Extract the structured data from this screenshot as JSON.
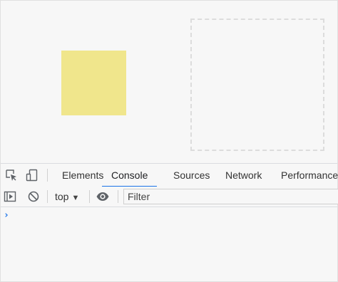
{
  "page": {
    "square_color": "#f0e68c",
    "dropzone_border_color": "#dcdcdc"
  },
  "devtools": {
    "toolbar_icons": [
      "inspect-element-icon",
      "device-toolbar-icon"
    ],
    "tabs": [
      {
        "label": "Elements",
        "active": false
      },
      {
        "label": "Console",
        "active": true
      },
      {
        "label": "Sources",
        "active": false
      },
      {
        "label": "Network",
        "active": false
      },
      {
        "label": "Performance",
        "active": false
      }
    ],
    "accent_color": "#1a73e8",
    "console": {
      "toolbar_icons": [
        "show-sidebar-icon",
        "clear-console-icon",
        "eye-icon"
      ],
      "context": "top",
      "filter_placeholder": "Filter",
      "prompt_symbol": "›"
    }
  }
}
